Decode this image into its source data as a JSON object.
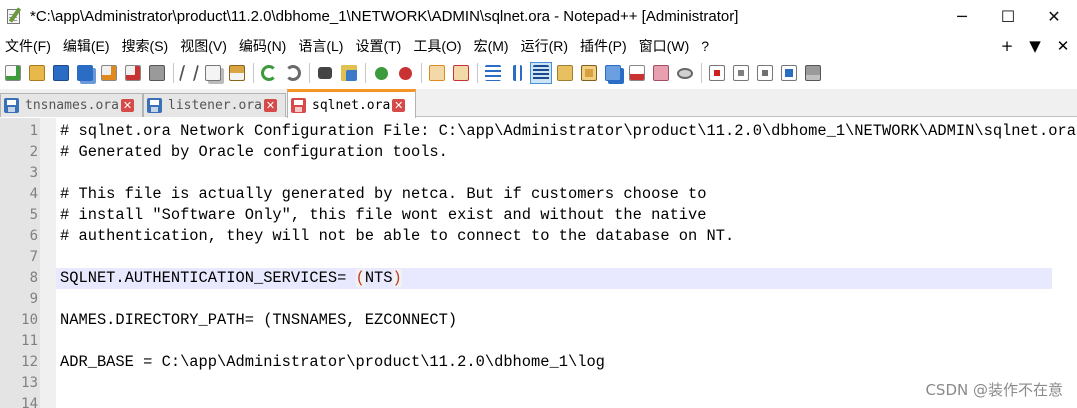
{
  "window": {
    "title": "*C:\\app\\Administrator\\product\\11.2.0\\dbhome_1\\NETWORK\\ADMIN\\sqlnet.ora - Notepad++ [Administrator]",
    "minimize": "─",
    "maximize": "☐",
    "close": "✕"
  },
  "menu": {
    "items": [
      "文件(F)",
      "编辑(E)",
      "搜索(S)",
      "视图(V)",
      "编码(N)",
      "语言(L)",
      "设置(T)",
      "工具(O)",
      "宏(M)",
      "运行(R)",
      "插件(P)",
      "窗口(W)",
      "?"
    ],
    "right": [
      "+",
      "▼",
      "✕"
    ]
  },
  "toolbar": {
    "icons": [
      "new-file-icon",
      "open-file-icon",
      "save-icon",
      "save-all-icon",
      "close-icon",
      "close-all-icon",
      "print-icon",
      "cut-icon",
      "copy-icon",
      "paste-icon",
      "undo-icon",
      "redo-icon",
      "find-icon",
      "replace-icon",
      "zoom-in-icon",
      "zoom-out-icon",
      "sync-vertical-icon",
      "sync-horizontal-icon",
      "word-wrap-icon",
      "show-all-chars-icon",
      "indent-guide-icon",
      "lang-define-icon",
      "doc-map-icon",
      "function-list-icon",
      "folder-workspace-icon",
      "monitor-icon",
      "record-macro-icon",
      "stop-macro-icon",
      "play-macro-icon",
      "run-macro-multiple-icon",
      "save-macro-icon"
    ],
    "colors": {
      "blue": "#2b6cc4",
      "green": "#3c9a3c",
      "orange": "#e08a1e",
      "red": "#c83232",
      "gray": "#808080"
    }
  },
  "tabs": [
    {
      "label": "tnsnames.ora",
      "icon_color": "#3b6fb6"
    },
    {
      "label": "listener.ora",
      "icon_color": "#3b6fb6"
    },
    {
      "label": "sqlnet.ora",
      "icon_color": "#d64a4a"
    }
  ],
  "editor": {
    "lines": [
      {
        "n": "1",
        "text": "# sqlnet.ora Network Configuration File: C:\\app\\Administrator\\product\\11.2.0\\dbhome_1\\NETWORK\\ADMIN\\sqlnet.ora"
      },
      {
        "n": "2",
        "text": "# Generated by Oracle configuration tools."
      },
      {
        "n": "3",
        "text": ""
      },
      {
        "n": "4",
        "text": "# This file is actually generated by netca. But if customers choose to"
      },
      {
        "n": "5",
        "text": "# install \"Software Only\", this file wont exist and without the native"
      },
      {
        "n": "6",
        "text": "# authentication, they will not be able to connect to the database on NT."
      },
      {
        "n": "7",
        "text": ""
      },
      {
        "n": "8",
        "pre": "SQLNET.AUTHENTICATION_SERVICES= ",
        "paren_open": "(",
        "mid": "NTS",
        "paren_close": ")"
      },
      {
        "n": "9",
        "text": ""
      },
      {
        "n": "10",
        "text": "NAMES.DIRECTORY_PATH= (TNSNAMES, EZCONNECT)"
      },
      {
        "n": "11",
        "text": ""
      },
      {
        "n": "12",
        "text": "ADR_BASE = C:\\app\\Administrator\\product\\11.2.0\\dbhome_1\\log"
      },
      {
        "n": "13",
        "text": ""
      },
      {
        "n": "14",
        "text": ""
      }
    ]
  },
  "watermark": "CSDN @装作不在意"
}
